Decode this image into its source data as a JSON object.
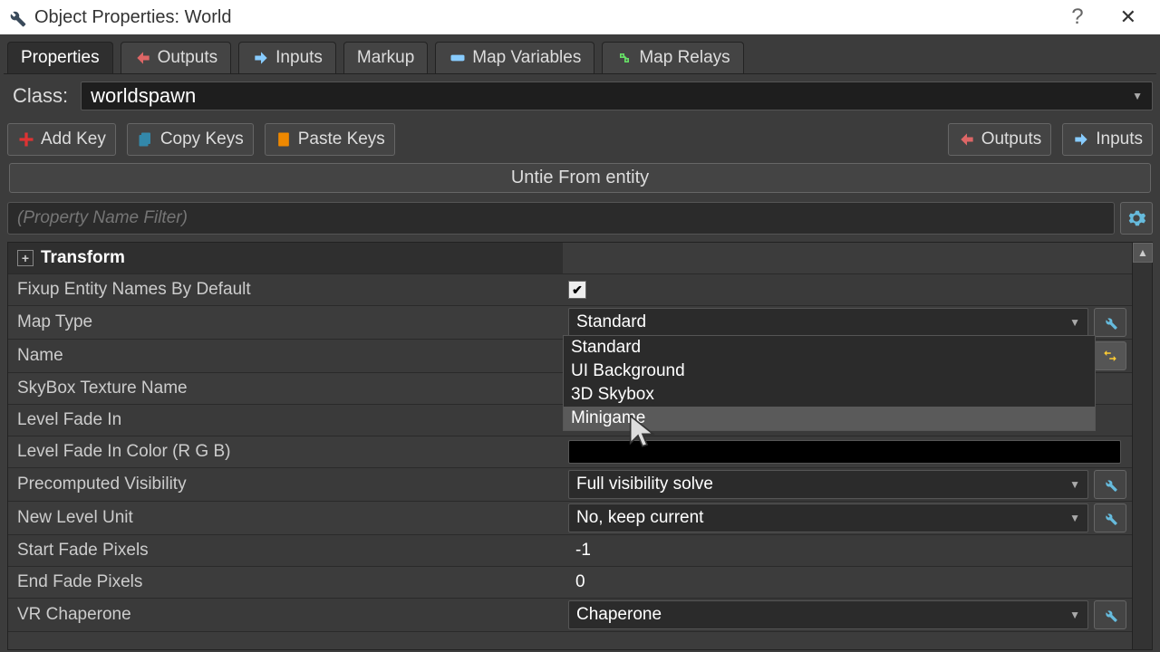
{
  "title": "Object Properties: World",
  "tabs": [
    "Properties",
    "Outputs",
    "Inputs",
    "Markup",
    "Map Variables",
    "Map Relays"
  ],
  "class_label": "Class:",
  "class_value": "worldspawn",
  "buttons": {
    "add": "Add Key",
    "copy": "Copy Keys",
    "paste": "Paste Keys",
    "outputs": "Outputs",
    "inputs": "Inputs",
    "untie": "Untie From entity"
  },
  "filter_placeholder": "(Property Name Filter)",
  "group_transform": "Transform",
  "props": {
    "fixup": "Fixup Entity Names By Default",
    "maptype": "Map Type",
    "name": "Name",
    "skybox": "SkyBox Texture Name",
    "fadein": "Level Fade In",
    "fadecolor": "Level Fade In Color (R G B)",
    "vis": "Precomputed Visibility",
    "newlevel": "New Level Unit",
    "startfade": "Start Fade Pixels",
    "endfade": "End Fade Pixels",
    "vrchap": "VR Chaperone"
  },
  "values": {
    "maptype": "Standard",
    "vis": "Full visibility solve",
    "newlevel": "No, keep current",
    "startfade": "-1",
    "endfade": "0",
    "vrchap": "Chaperone"
  },
  "maptype_options": [
    "Standard",
    "UI Background",
    "3D Skybox",
    "Minigame"
  ]
}
